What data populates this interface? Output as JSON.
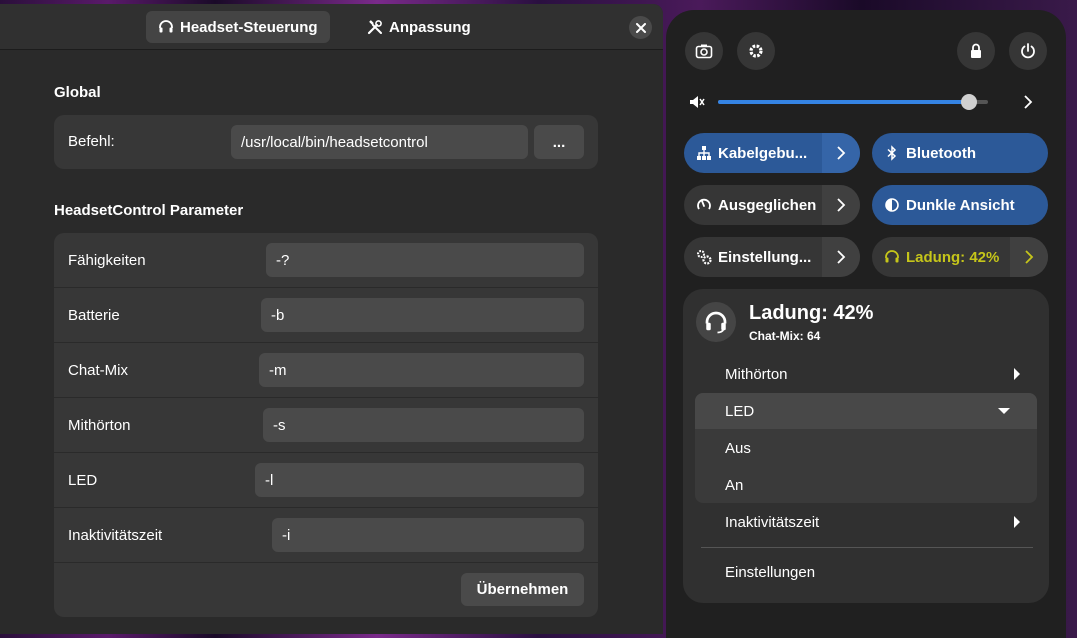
{
  "prefs": {
    "tabs": [
      {
        "label": "Headset-Steuerung",
        "icon": "headset-icon"
      },
      {
        "label": "Anpassung",
        "icon": "tools-icon"
      }
    ],
    "global_title": "Global",
    "command_label": "Befehl:",
    "command_value": "/usr/local/bin/headsetcontrol",
    "browse_label": "...",
    "params_title": "HeadsetControl Parameter",
    "params": [
      {
        "label": "Fähigkeiten",
        "value": "-?"
      },
      {
        "label": "Batterie",
        "value": "-b"
      },
      {
        "label": "Chat-Mix",
        "value": "-m"
      },
      {
        "label": "Mithörton",
        "value": "-s"
      },
      {
        "label": "LED",
        "value": "-l"
      },
      {
        "label": "Inaktivitätszeit",
        "value": "-i"
      }
    ],
    "apply_label": "Übernehmen"
  },
  "quick_settings": {
    "volume_level": 0.93,
    "toggles": [
      {
        "label": "Kabelgebu...",
        "icon": "network-icon",
        "state": "on"
      },
      {
        "label": "Bluetooth",
        "icon": "bluetooth-icon",
        "state": "on"
      },
      {
        "label": "Ausgeglichen",
        "icon": "power-profile-icon",
        "state": "off"
      },
      {
        "label": "Dunkle Ansicht",
        "icon": "dark-mode-icon",
        "state": "on"
      },
      {
        "label": "Einstellung...",
        "icon": "settings-cog-icon",
        "state": "off"
      },
      {
        "label": "Ladung: 42%",
        "icon": "headset-icon",
        "state": "yellow"
      }
    ],
    "accent_color": "#2c5998",
    "warning_color": "#c5c51a",
    "headset_title": "Ladung: 42%",
    "headset_subtitle": "Chat-Mix: 64",
    "menu": {
      "sidetone": "Mithörton",
      "led": "LED",
      "led_options": [
        "Aus",
        "An"
      ],
      "inactive": "Inaktivitätszeit",
      "settings": "Einstellungen"
    }
  }
}
